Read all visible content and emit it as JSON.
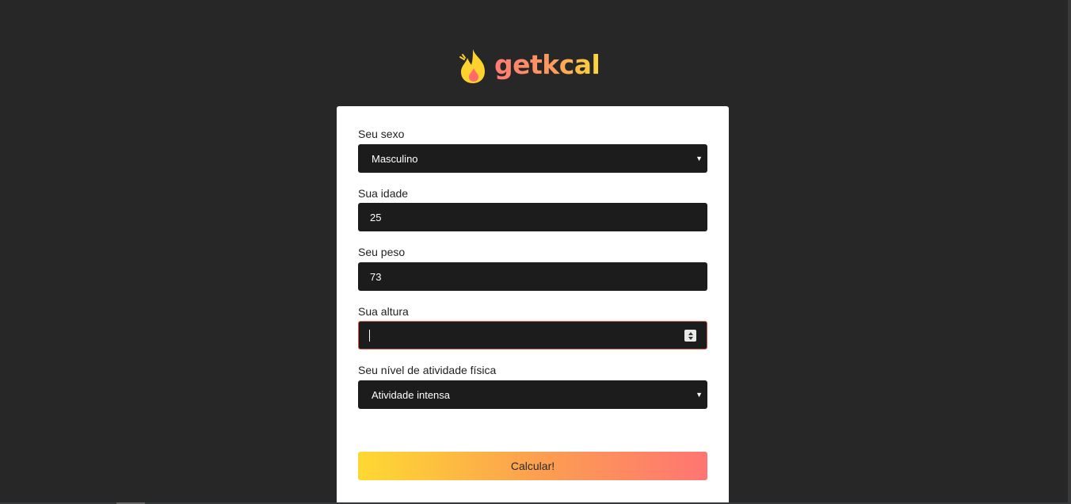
{
  "brand": {
    "name": "getkcal",
    "logo_icon": "flame-icon",
    "colors": {
      "gradient_start": "#ff7b74",
      "gradient_end": "#fdd93a",
      "flame_outer": "#fdd22e",
      "flame_inner": "#ff6b6b"
    }
  },
  "form": {
    "sex": {
      "label": "Seu sexo",
      "value": "Masculino"
    },
    "age": {
      "label": "Sua idade",
      "value": "25"
    },
    "weight": {
      "label": "Seu peso",
      "value": "73"
    },
    "height": {
      "label": "Sua altura",
      "value": ""
    },
    "activity": {
      "label": "Seu nível de atividade física",
      "value": "Atividade intensa"
    },
    "submit_label": "Calcular!"
  },
  "theme": {
    "page_background": "#272727",
    "control_background": "#1c1c1c",
    "focus_border": "#e0524a",
    "button_gradient": [
      "#fed932",
      "#fca14f",
      "#fe7572"
    ]
  }
}
